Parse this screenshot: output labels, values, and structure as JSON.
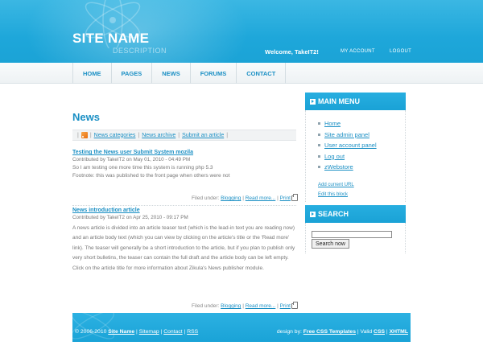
{
  "header": {
    "site_name": "SITE NAME",
    "site_description": "DESCRIPTION",
    "welcome": "Welcome, TakeIT2!",
    "my_account": "MY ACCOUNT",
    "logout": "LOGOUT"
  },
  "nav": {
    "items": [
      "HOME",
      "PAGES",
      "NEWS",
      "FORUMS",
      "CONTACT"
    ]
  },
  "main": {
    "title": "News",
    "subnav": [
      "News categories",
      "News archive",
      "Submit an article"
    ],
    "articles": [
      {
        "title": "Testing the News user Submit System mozila",
        "meta": "Contributed by TakeIT2 on May 01, 2010 - 04:49 PM",
        "body": "So I am testing one more time this system is running php 5.3",
        "footnote": "Footnote: this was published to the front page when others were not",
        "filed_under": "Filed under:",
        "category": "Blogging",
        "read_more": "Read more...",
        "print": "Print"
      },
      {
        "title": "News introduction article",
        "meta": "Contributed by TakeIT2 on Apr 25, 2010 - 09:17 PM",
        "body": "A news article is divided into an article teaser text (which is the lead-in text you are reading now) and an article body text (which you can view by clicking on the article's title or the 'Read more' link). The teaser will generally be a short introduction to the article, but if you plan to publish only very short bulletins, the teaser can contain the full draft and the article body can be left empty. Click on the article title for more information about Zikula's News publisher module.",
        "filed_under": "Filed under:",
        "category": "Blogging",
        "read_more": "Read more...",
        "print": "Print"
      }
    ]
  },
  "sidebar": {
    "main_menu_title": "MAIN MENU",
    "menu_items": [
      "Home",
      "Site admin panel",
      "User account panel",
      "Log out",
      "zWebstore"
    ],
    "add_current_url": "Add current URL",
    "edit_block": "Edit this block",
    "search_title": "SEARCH",
    "search_button": "Search now"
  },
  "footer": {
    "copyright": "© 2006-2010",
    "site_name": "Site Name",
    "links": [
      "Sitemap",
      "Contact",
      "RSS"
    ],
    "design_by": "design by:",
    "templates": "Free CSS Templates",
    "valid": "Valid",
    "css": "CSS",
    "xhtml": "XHTML"
  },
  "colors": {
    "accent": "#1a8fc4",
    "header_blue": "#1ea7da",
    "nav_bg": "#eef2f4"
  }
}
